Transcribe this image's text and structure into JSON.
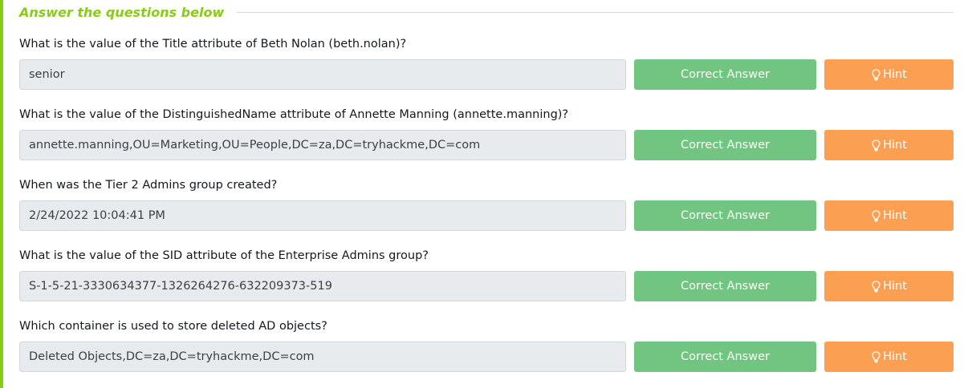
{
  "section": {
    "title": "Answer the questions below"
  },
  "colors": {
    "accent": "#88cc14",
    "correct_button": "#72c481",
    "hint_button": "#fb9f52",
    "input_background": "#e8ebee"
  },
  "questions": [
    {
      "text": "What is the value of the Title attribute of Beth Nolan (beth.nolan)?",
      "answer": "senior",
      "correct_label": "Correct Answer",
      "hint_label": "Hint",
      "hint_icon": "lightbulb-icon"
    },
    {
      "text": "What is the value of the DistinguishedName attribute of Annette Manning (annette.manning)?",
      "answer": "annette.manning,OU=Marketing,OU=People,DC=za,DC=tryhackme,DC=com",
      "correct_label": "Correct Answer",
      "hint_label": "Hint",
      "hint_icon": "lightbulb-icon"
    },
    {
      "text": "When was the Tier 2 Admins group created?",
      "answer": "2/24/2022 10:04:41 PM",
      "correct_label": "Correct Answer",
      "hint_label": "Hint",
      "hint_icon": "lightbulb-icon"
    },
    {
      "text": "What is the value of the SID attribute of the Enterprise Admins group?",
      "answer": "S-1-5-21-3330634377-1326264276-632209373-519",
      "correct_label": "Correct Answer",
      "hint_label": "Hint",
      "hint_icon": "lightbulb-icon"
    },
    {
      "text": "Which container is used to store deleted AD objects?",
      "answer": "Deleted Objects,DC=za,DC=tryhackme,DC=com",
      "correct_label": "Correct Answer",
      "hint_label": "Hint",
      "hint_icon": "lightbulb-icon"
    }
  ]
}
